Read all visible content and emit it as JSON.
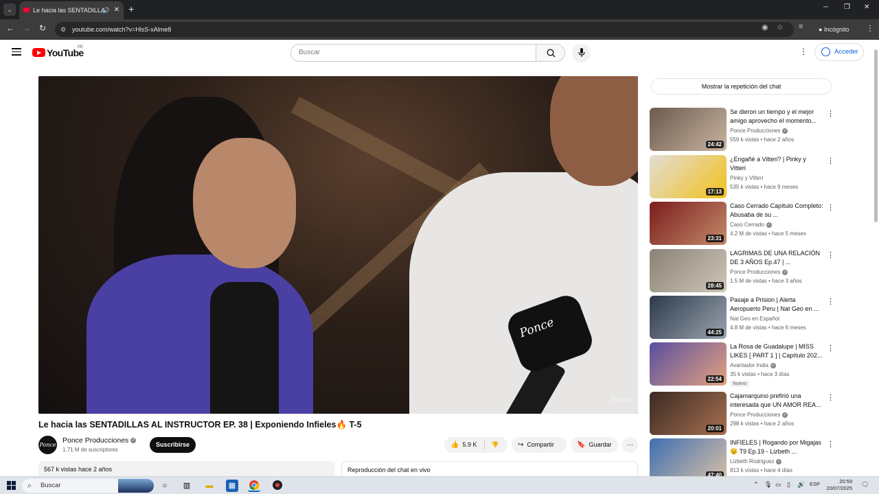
{
  "browser": {
    "tab_title": "Le hacia las SENTADILLAS A",
    "url": "youtube.com/watch?v=HlsS-xAlme8",
    "profile_label": "Incógnito",
    "new_tab_glyph": "+"
  },
  "header": {
    "logo_text": "YouTube",
    "country_code": "PE",
    "search_placeholder": "Buscar",
    "signin_label": "Acceder"
  },
  "video": {
    "watermark": "Ponce",
    "mic_logo": "Ponce",
    "title": "Le hacia las SENTADILLAS AL INSTRUCTOR EP. 38 | Exponiendo Infieles🔥 T-5",
    "channel": "Ponce Producciones",
    "channel_avatar_text": "Ponce",
    "subscribers": "1.71 M de suscriptores",
    "subscribe_label": "Suscribirse",
    "likes": "5.9 K",
    "share_label": "Compartir",
    "save_label": "Guardar",
    "views_date": "567 k vistas  hace 2 años",
    "chat_replay_label": "Reproducción del chat en vivo"
  },
  "sidebar": {
    "show_chat_label": "Mostrar la repetición del chat",
    "recommendations": [
      {
        "title": "Se dieron un tiempo y el mejor amigo aprovecho el momento...",
        "channel": "Ponce Producciones",
        "verified": true,
        "meta": "559 k vistas • hace 2 años",
        "duration": "24:42",
        "thumb_colors": [
          "#6b5a4e",
          "#c9b4a0"
        ]
      },
      {
        "title": "¿Engañé a Vitteri? | Pinky y Vitteri",
        "channel": "Pinky y Vitteri",
        "verified": false,
        "meta": "535 k vistas • hace 9 meses",
        "duration": "17:13",
        "thumb_colors": [
          "#e2ddd6",
          "#f2c21b"
        ]
      },
      {
        "title": "Caso Cerrado Capítulo Completo: Abusaba de su ...",
        "channel": "Caso Cerrado",
        "verified": true,
        "meta": "4.2 M de vistas • hace 5 meses",
        "duration": "23:31",
        "thumb_colors": [
          "#7b1d1d",
          "#c48a6a"
        ]
      },
      {
        "title": "LAGRIMAS DE UNA RELACIÓN DE 3 AÑOS Ep.47 | ...",
        "channel": "Ponce Producciones",
        "verified": true,
        "meta": "1.5 M de vistas • hace 3 años",
        "duration": "28:45",
        "thumb_colors": [
          "#8a8276",
          "#cfc6b8"
        ]
      },
      {
        "title": "Pasaje a Prision | Alerta Aeropuerto Peru | Nat Geo en ...",
        "channel": "Nat Geo en Español",
        "verified": false,
        "meta": "4.8 M de vistas • hace 6 meses",
        "duration": "44:25",
        "thumb_colors": [
          "#2d3a4a",
          "#9aa4b0"
        ]
      },
      {
        "title": "La Rosa de Guadalupe | MISS LIKES [ PART 1 ] | Capítulo 202...",
        "channel": "Avantador India",
        "verified": true,
        "meta": "35 k vistas • hace 3 días",
        "duration": "22:54",
        "thumb_colors": [
          "#5a4ea0",
          "#e3a37e"
        ],
        "badge": "Nuevo"
      },
      {
        "title": "Cajamarquino prefirió una interesada que UN AMOR REA...",
        "channel": "Ponce Producciones",
        "verified": true,
        "meta": "298 k vistas • hace 2 años",
        "duration": "20:01",
        "thumb_colors": [
          "#3a2b24",
          "#a86f4f"
        ]
      },
      {
        "title": "INFIELES | Rogando por Migajas 😉 T9 Ep.19 - Lizbeth ...",
        "channel": "Lizbeth Rodriguez",
        "verified": true,
        "meta": "813 k vistas • hace 4 días",
        "duration": "47:40",
        "thumb_colors": [
          "#3f6fb0",
          "#d8c0a8"
        ]
      }
    ]
  },
  "taskbar": {
    "search_label": "Buscar",
    "language": "ESP",
    "time": "20:59",
    "date": "20/07/2025"
  },
  "colors": {
    "youtube_red": "#ff0000",
    "signin_blue": "#065fd4",
    "chrome_dark": "#202124"
  }
}
